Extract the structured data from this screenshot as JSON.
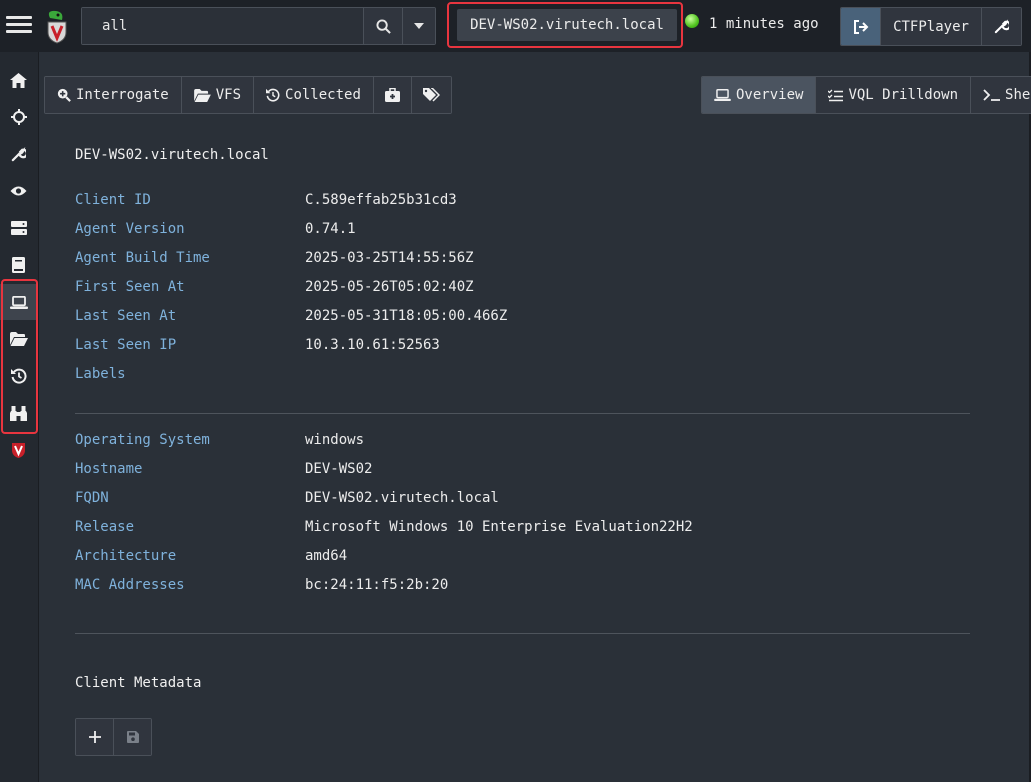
{
  "search": {
    "value": "all"
  },
  "header": {
    "hostname": "DEV-WS02.virutech.local",
    "status": "1 minutes ago",
    "user": "CTFPlayer"
  },
  "sidebar": {
    "items": [
      {
        "icon": "home-icon"
      },
      {
        "icon": "crosshairs-icon"
      },
      {
        "icon": "wrench-icon"
      },
      {
        "icon": "eye-icon"
      },
      {
        "icon": "server-icon"
      },
      {
        "icon": "book-icon"
      },
      {
        "icon": "laptop-icon"
      },
      {
        "icon": "folder-open-icon"
      },
      {
        "icon": "history-icon"
      },
      {
        "icon": "binoculars-icon"
      },
      {
        "icon": "velociraptor-icon"
      }
    ]
  },
  "toolbar": {
    "left": [
      "Interrogate",
      "VFS",
      "Collected"
    ],
    "right": [
      "Overview",
      "VQL Drilldown",
      "She"
    ]
  },
  "client": {
    "title": "DEV-WS02.virutech.local",
    "fields": [
      {
        "label": "Client ID",
        "value": "C.589effab25b31cd3"
      },
      {
        "label": "Agent Version",
        "value": "0.74.1"
      },
      {
        "label": "Agent Build Time",
        "value": "2025-03-25T14:55:56Z"
      },
      {
        "label": "First Seen At",
        "value": "2025-05-26T05:02:40Z"
      },
      {
        "label": "Last Seen At",
        "value": "2025-05-31T18:05:00.466Z"
      },
      {
        "label": "Last Seen IP",
        "value": "10.3.10.61:52563"
      },
      {
        "label": "Labels",
        "value": ""
      }
    ],
    "os_fields": [
      {
        "label": "Operating System",
        "value": "windows"
      },
      {
        "label": "Hostname",
        "value": "DEV-WS02"
      },
      {
        "label": "FQDN",
        "value": "DEV-WS02.virutech.local"
      },
      {
        "label": "Release",
        "value": "Microsoft Windows 10 Enterprise Evaluation22H2"
      },
      {
        "label": "Architecture",
        "value": "amd64"
      },
      {
        "label": "MAC Addresses",
        "value": "bc:24:11:f5:2b:20"
      }
    ],
    "metadata_title": "Client Metadata"
  },
  "colors": {
    "background": "#2a3038",
    "label_blue": "#7fb2dc",
    "highlight_red": "#e8353f",
    "status_green": "#4fc21e"
  }
}
